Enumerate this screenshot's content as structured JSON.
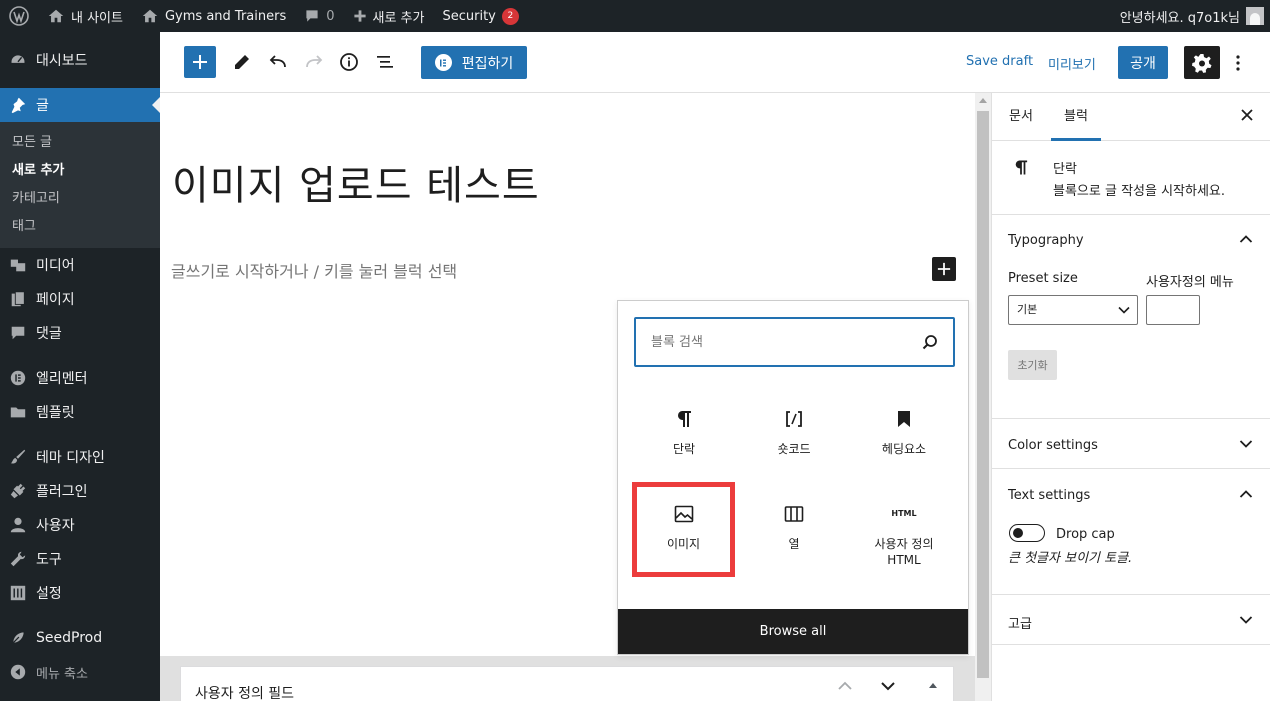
{
  "admin_bar": {
    "site_name": "내 사이트",
    "site2_name": "Gyms and Trainers",
    "comments_count": "0",
    "new_label": "새로 추가",
    "security_label": "Security",
    "security_count": "2",
    "greeting": "안녕하세요. q7o1k님"
  },
  "sidebar": {
    "items": [
      {
        "label": "대시보드",
        "icon": "dashboard-icon"
      },
      {
        "label": "글",
        "icon": "pin-icon",
        "current": true
      },
      {
        "label": "미디어",
        "icon": "media-icon"
      },
      {
        "label": "페이지",
        "icon": "pages-icon"
      },
      {
        "label": "댓글",
        "icon": "comments-icon"
      },
      {
        "label": "엘리멘터",
        "icon": "elementor-icon"
      },
      {
        "label": "템플릿",
        "icon": "folder-icon"
      },
      {
        "label": "테마 디자인",
        "icon": "brush-icon"
      },
      {
        "label": "플러그인",
        "icon": "plugin-icon"
      },
      {
        "label": "사용자",
        "icon": "user-icon"
      },
      {
        "label": "도구",
        "icon": "wrench-icon"
      },
      {
        "label": "설정",
        "icon": "settings-sliders-icon"
      },
      {
        "label": "SeedProd",
        "icon": "seedprod-icon"
      },
      {
        "label": "메뉴 축소",
        "icon": "collapse-icon"
      }
    ],
    "submenu": [
      "모든 글",
      "새로 추가",
      "카테고리",
      "태그"
    ]
  },
  "toolbar": {
    "elementor_label": "편집하기",
    "save_draft": "Save draft",
    "preview": "미리보기",
    "publish": "공개"
  },
  "editor": {
    "title": "이미지 업로드 테스트",
    "placeholder": "글쓰기로 시작하거나 / 키를 눌러 블럭 선택"
  },
  "inserter": {
    "search_placeholder": "블록 검색",
    "blocks": [
      {
        "label": "단락",
        "icon": "paragraph-icon"
      },
      {
        "label": "숏코드",
        "icon": "shortcode-icon"
      },
      {
        "label": "헤딩요소",
        "icon": "bookmark-icon"
      },
      {
        "label": "이미지",
        "icon": "image-icon",
        "highlighted": true
      },
      {
        "label": "열",
        "icon": "columns-icon"
      },
      {
        "label": "사용자 정의 HTML",
        "icon": "html-icon"
      }
    ],
    "html_icon_text": "HTML",
    "browse_all": "Browse all"
  },
  "meta_box": {
    "title": "사용자 정의 필드"
  },
  "settings": {
    "tab_document": "문서",
    "tab_block": "블럭",
    "block_name": "단락",
    "block_desc": "블록으로 글 작성을 시작하세요.",
    "typography_title": "Typography",
    "preset_size_label": "Preset size",
    "custom_size_label": "사용자정의 메뉴",
    "preset_value": "기본",
    "reset_label": "초기화",
    "color_settings_title": "Color settings",
    "text_settings_title": "Text settings",
    "drop_cap_label": "Drop cap",
    "drop_cap_help": "큰 첫글자 보이기 토글.",
    "advanced_title": "고급"
  },
  "colors": {
    "admin_dark": "#1d2327",
    "accent": "#2271b1",
    "highlight": "#ec3c3c"
  }
}
